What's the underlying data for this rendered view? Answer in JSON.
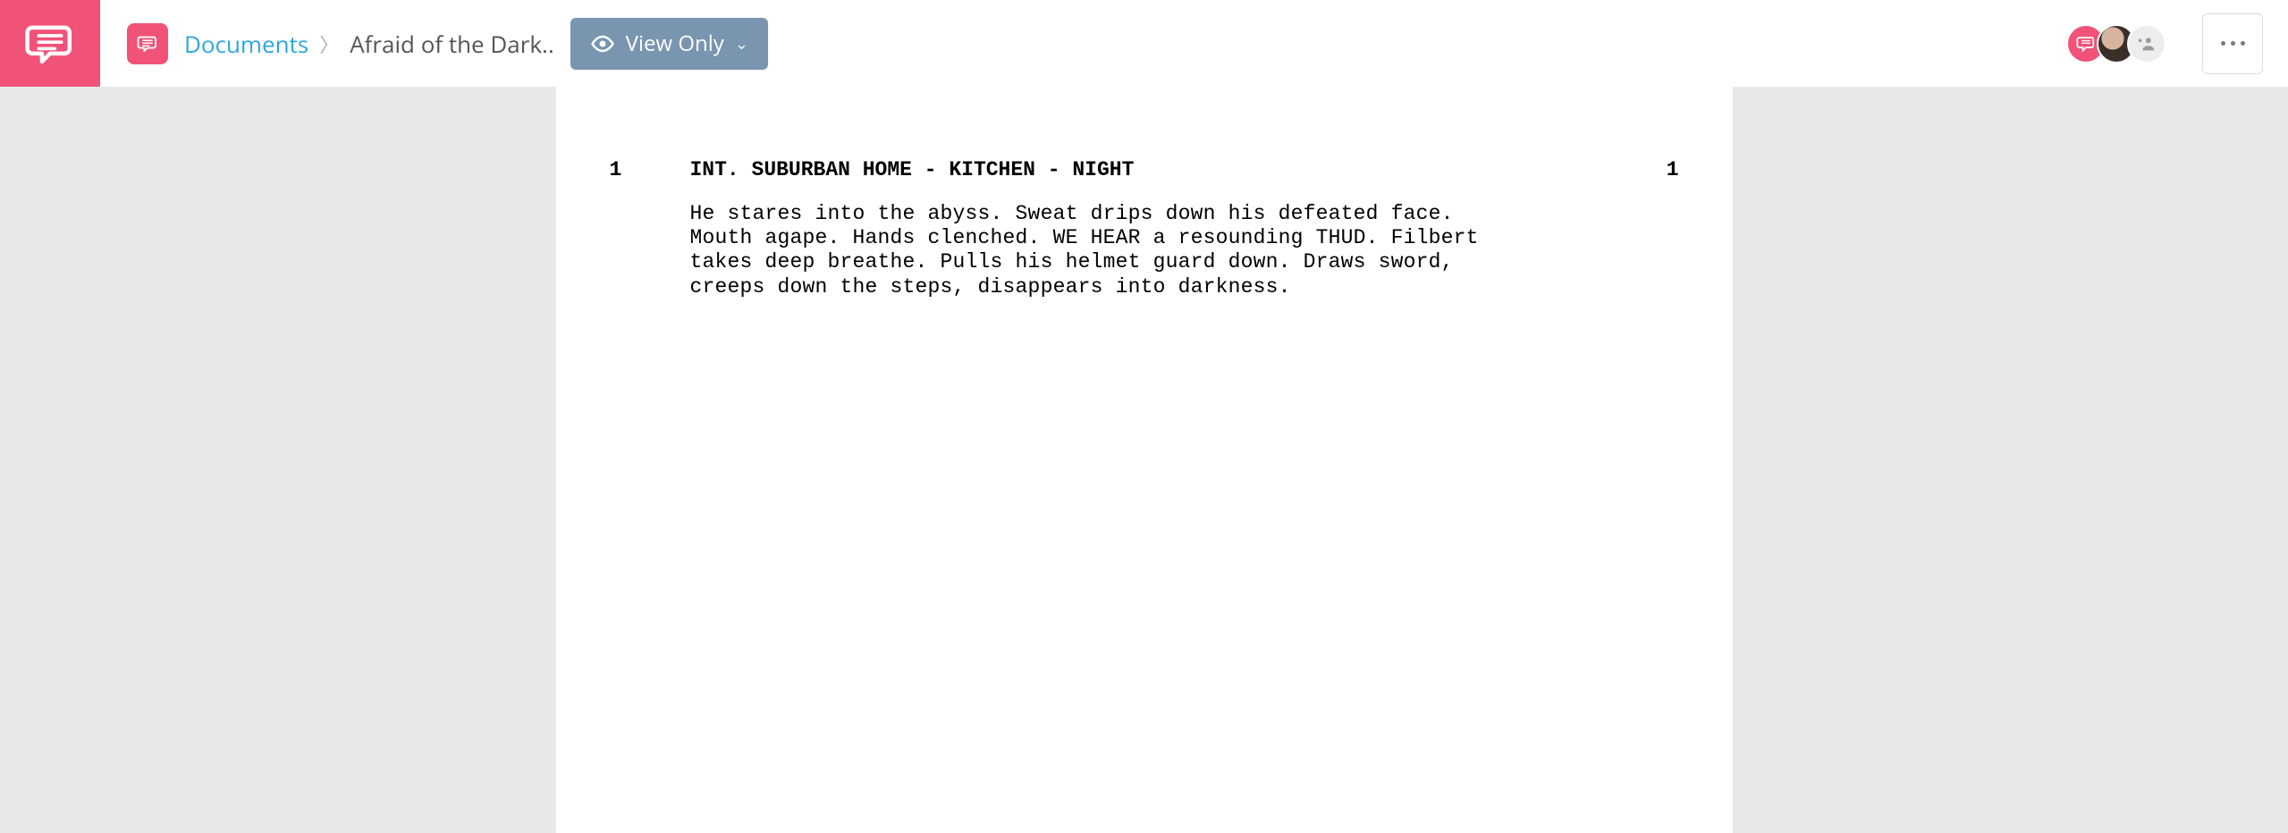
{
  "breadcrumb": {
    "root": "Documents",
    "title": "Afraid of the Dark.."
  },
  "toolbar": {
    "view_mode_label": "View Only"
  },
  "script": {
    "scene_number_left": "1",
    "scene_number_right": "1",
    "scene_heading": "INT. SUBURBAN HOME - KITCHEN - NIGHT",
    "action": "He stares into the abyss. Sweat drips down his defeated face. Mouth agape. Hands clenched. WE HEAR a resounding THUD. Filbert takes deep breathe. Pulls his helmet guard down. Draws sword, creeps down the steps, disappears into darkness."
  }
}
